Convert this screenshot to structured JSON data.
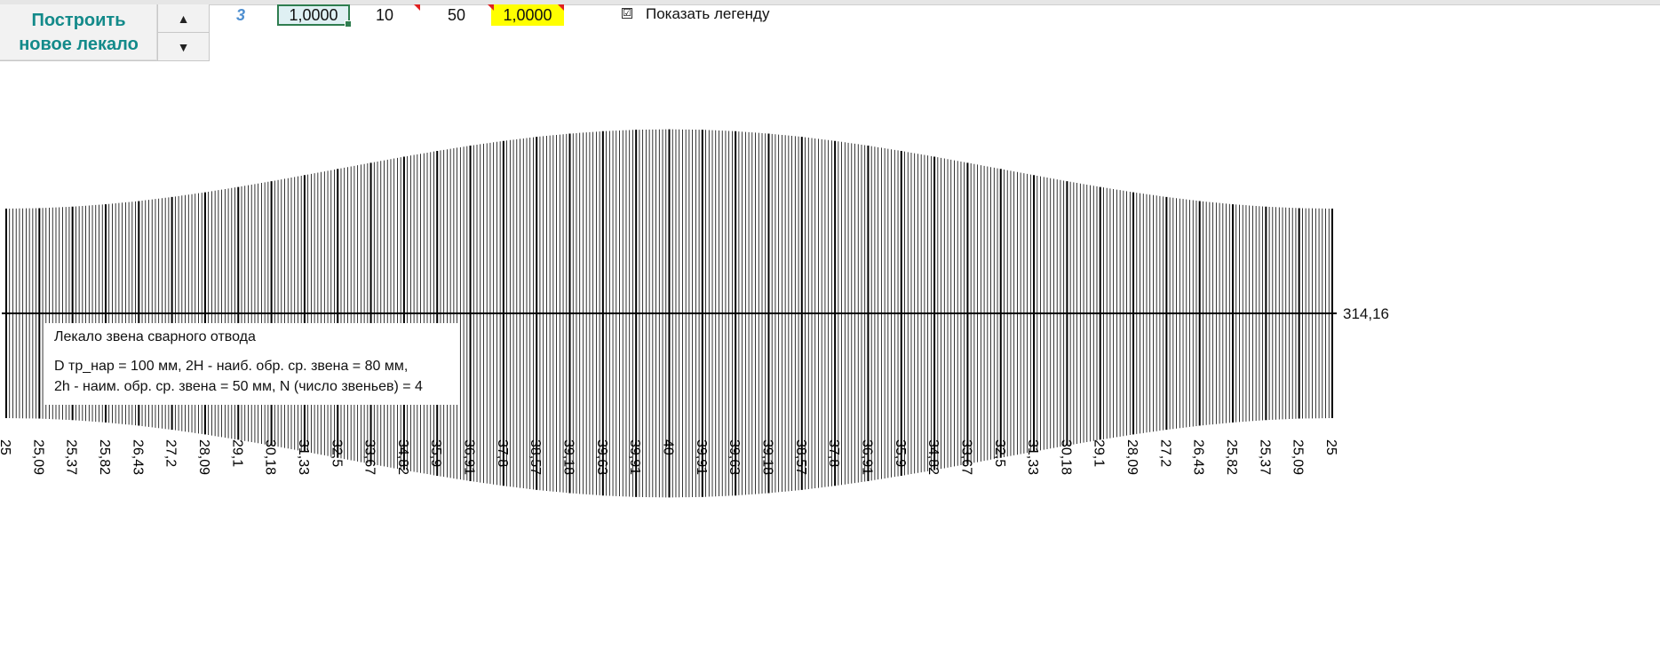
{
  "controls": {
    "build_button": "Построить новое лекало",
    "spin_up": "▲",
    "spin_down": "▼",
    "cell_num": "3",
    "cell_k": "1,0000",
    "cell_10": "10",
    "cell_50": "50",
    "cell_yellow": "1,0000",
    "legend_checkbox": "☑",
    "legend_label": "Показать легенду"
  },
  "legend": {
    "title": "Лекало звена сварного отвода",
    "line1": "D тр_нар = 100  мм, 2H - наиб. обр. ср. звена = 80  мм,",
    "line2": "2h - наим. обр. ср. звена = 50 мм, N (число звеньев) = 4"
  },
  "axis_value": "314,16",
  "chart_data": {
    "type": "bar",
    "description_values_mm": "ordinate heights of weld template, half-length per line",
    "x_total": "314,16",
    "tick_labels": [
      "25",
      "25,09",
      "25,37",
      "25,82",
      "26,43",
      "27,2",
      "28,09",
      "29,1",
      "30,18",
      "31,33",
      "32,5",
      "33,67",
      "34,82",
      "35,9",
      "36,91",
      "37,8",
      "38,57",
      "39,18",
      "39,63",
      "39,91",
      "40",
      "39,91",
      "39,63",
      "39,18",
      "38,57",
      "37,8",
      "36,91",
      "35,9",
      "34,82",
      "33,67",
      "32,5",
      "31,33",
      "30,18",
      "29,1",
      "28,09",
      "27,2",
      "26,43",
      "25,82",
      "25,37",
      "25,09",
      "25"
    ],
    "values": [
      25,
      25.09,
      25.37,
      25.82,
      26.43,
      27.2,
      28.09,
      29.1,
      30.18,
      31.33,
      32.5,
      33.67,
      34.82,
      35.9,
      36.91,
      37.8,
      38.57,
      39.18,
      39.63,
      39.91,
      40,
      39.91,
      39.63,
      39.18,
      38.57,
      37.8,
      36.91,
      35.9,
      34.82,
      33.67,
      32.5,
      31.33,
      30.18,
      29.1,
      28.09,
      27.2,
      26.43,
      25.82,
      25.37,
      25.09,
      25
    ],
    "ylim": [
      -40,
      40
    ],
    "minor_lines_per_interval": 10
  }
}
